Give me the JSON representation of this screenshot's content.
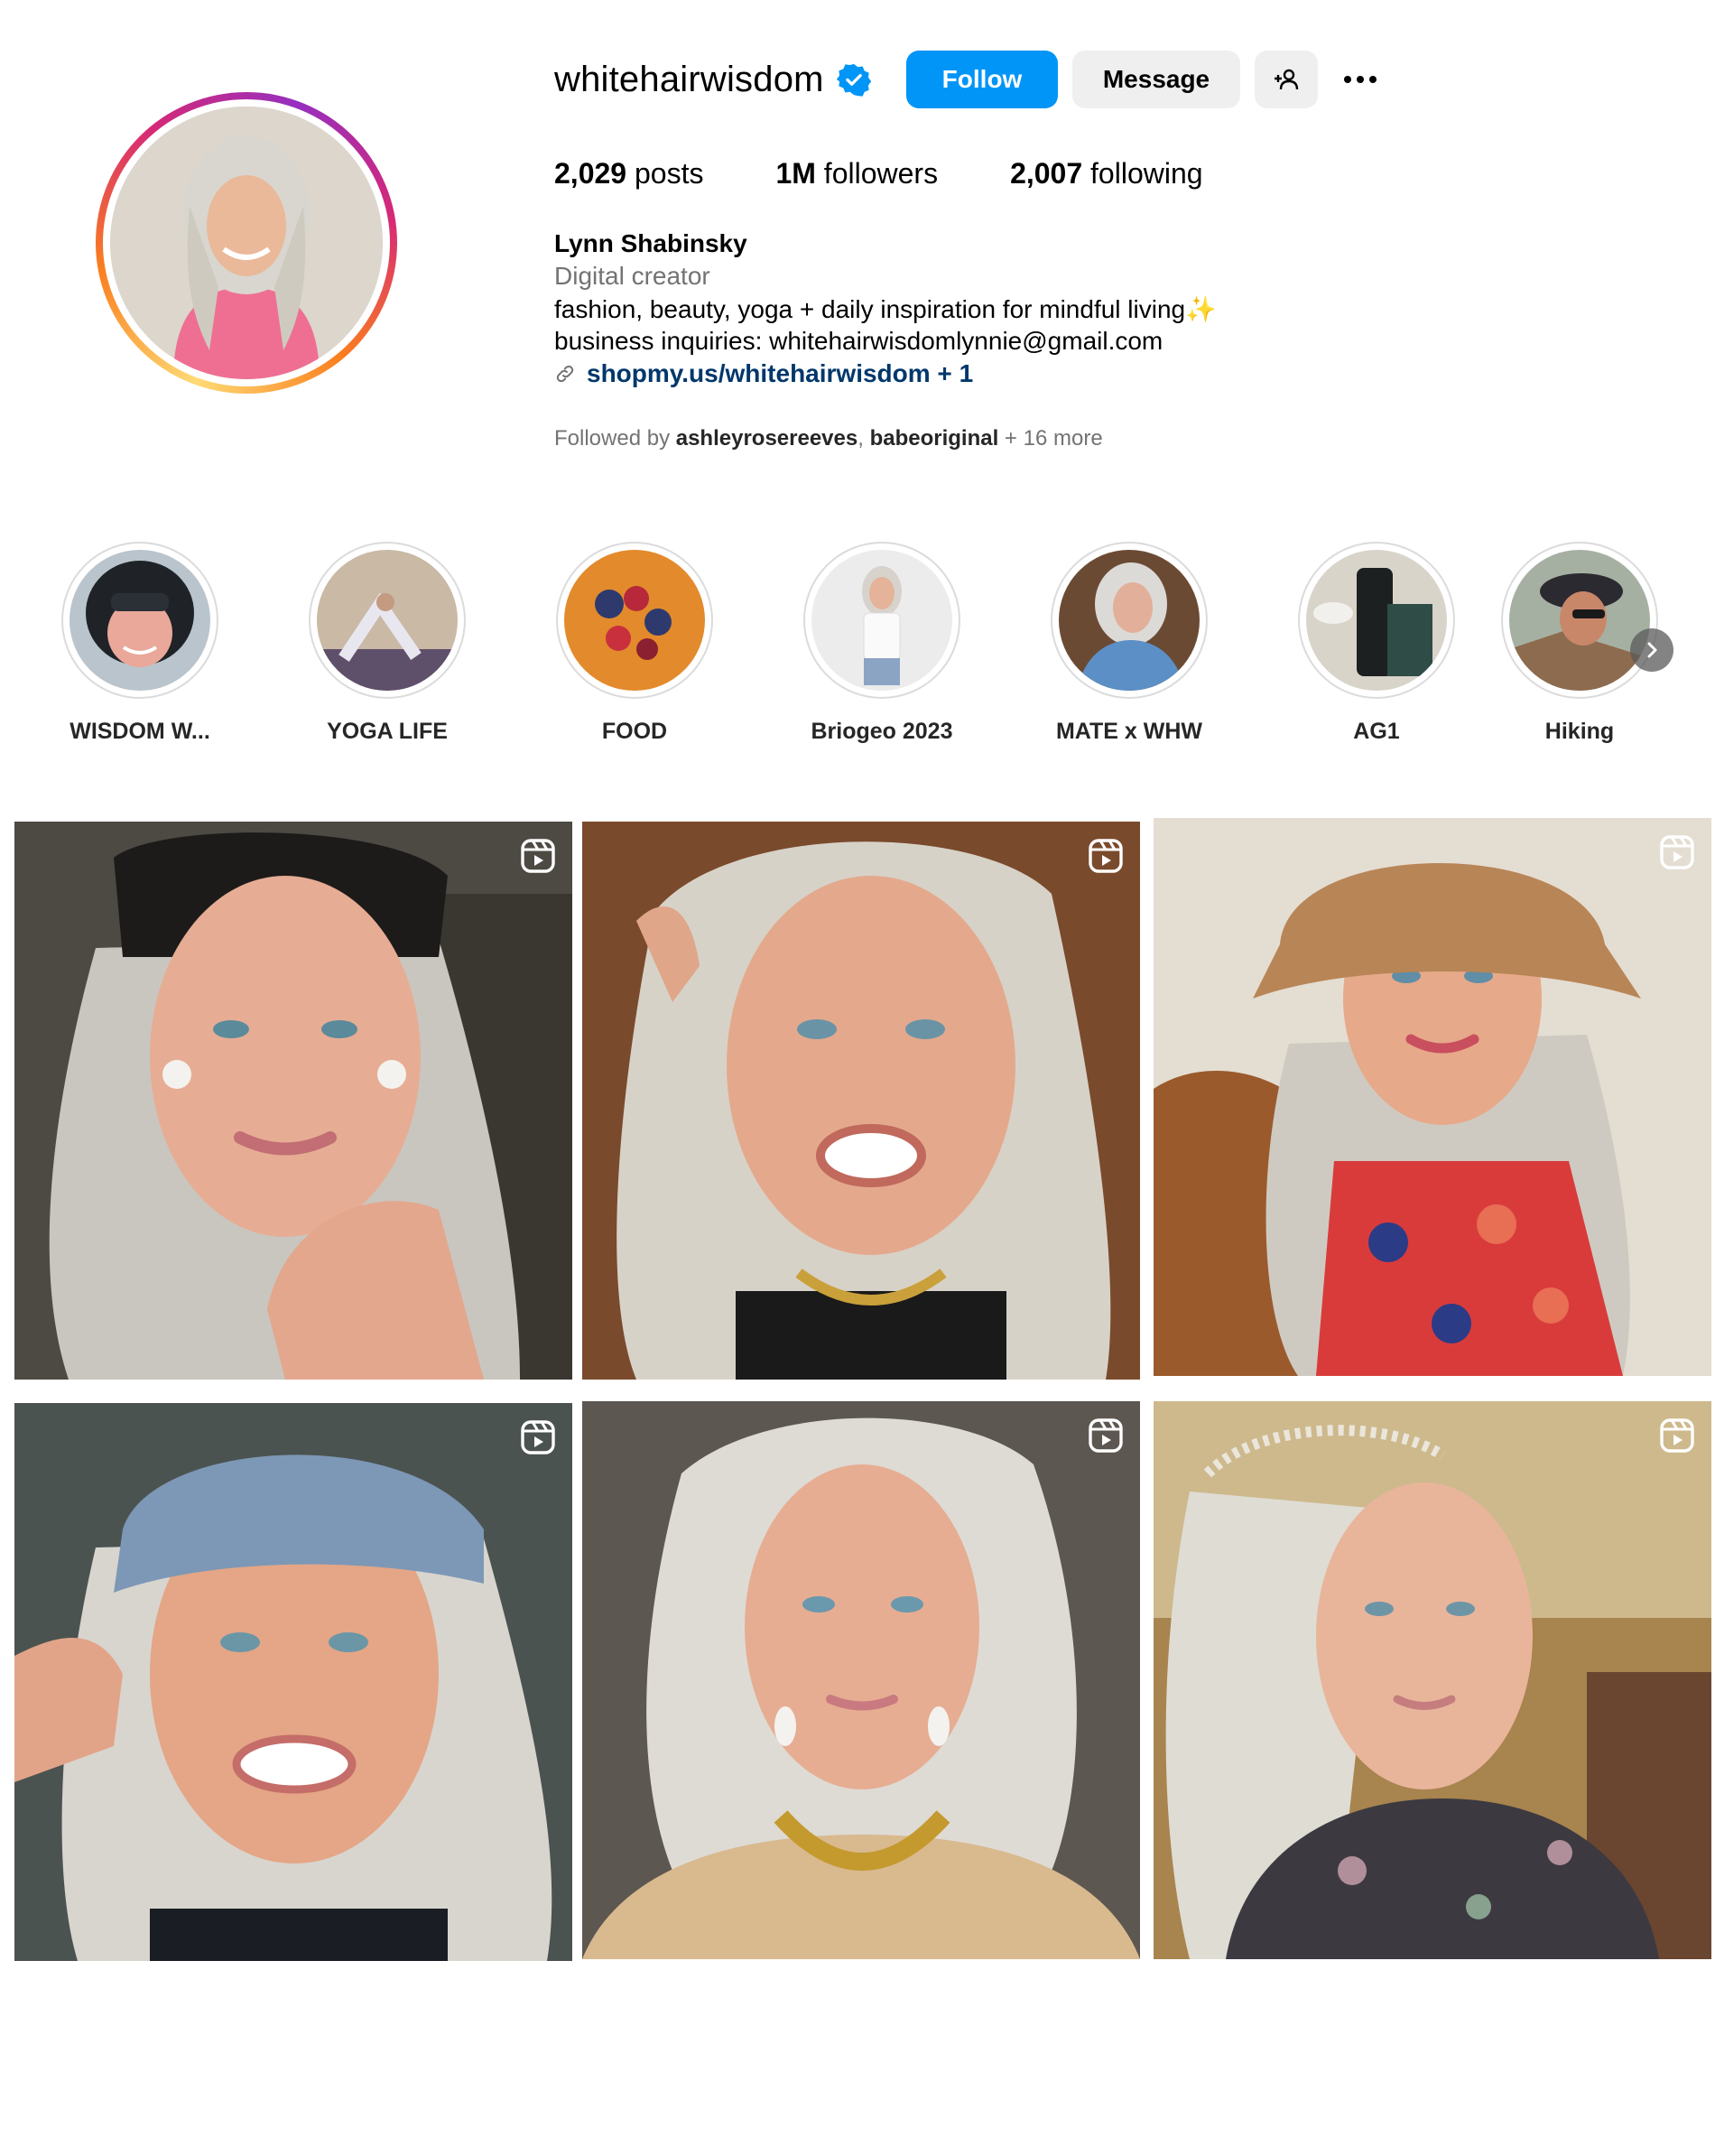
{
  "profile": {
    "username": "whitehairwisdom",
    "follow_label": "Follow",
    "message_label": "Message",
    "stats": {
      "posts_count": "2,029",
      "posts_label": " posts",
      "followers_count": "1M",
      "followers_label": " followers",
      "following_count": "2,007",
      "following_label": " following"
    },
    "full_name": "Lynn Shabinsky",
    "category": "Digital creator",
    "bio_line1": "fashion, beauty, yoga + daily inspiration for mindful living✨",
    "bio_line2": "business inquiries: whitehairwisdomlynnie@gmail.com",
    "link": "shopmy.us/whitehairwisdom + 1",
    "followed_by_prefix": "Followed by ",
    "followed_by_user1": "ashleyrosereeves",
    "followed_by_sep": ", ",
    "followed_by_user2": "babeoriginal",
    "followed_by_suffix": " + 16 more"
  },
  "highlights": [
    {
      "label": "WISDOM W..."
    },
    {
      "label": "YOGA LIFE"
    },
    {
      "label": "FOOD"
    },
    {
      "label": "Briogeo 2023"
    },
    {
      "label": "MATE x WHW"
    },
    {
      "label": "AG1"
    },
    {
      "label": "Hiking"
    }
  ],
  "colors": {
    "follow_button": "#0095f6",
    "secondary_button": "#efefef",
    "link": "#00376b",
    "muted_text": "#737373",
    "verified_badge": "#0095f6"
  },
  "icons": {
    "verified": "verified-badge-icon",
    "suggest": "add-person-icon",
    "more": "more-options-icon",
    "link": "link-icon",
    "reel": "reel-icon",
    "next": "chevron-right-icon"
  }
}
